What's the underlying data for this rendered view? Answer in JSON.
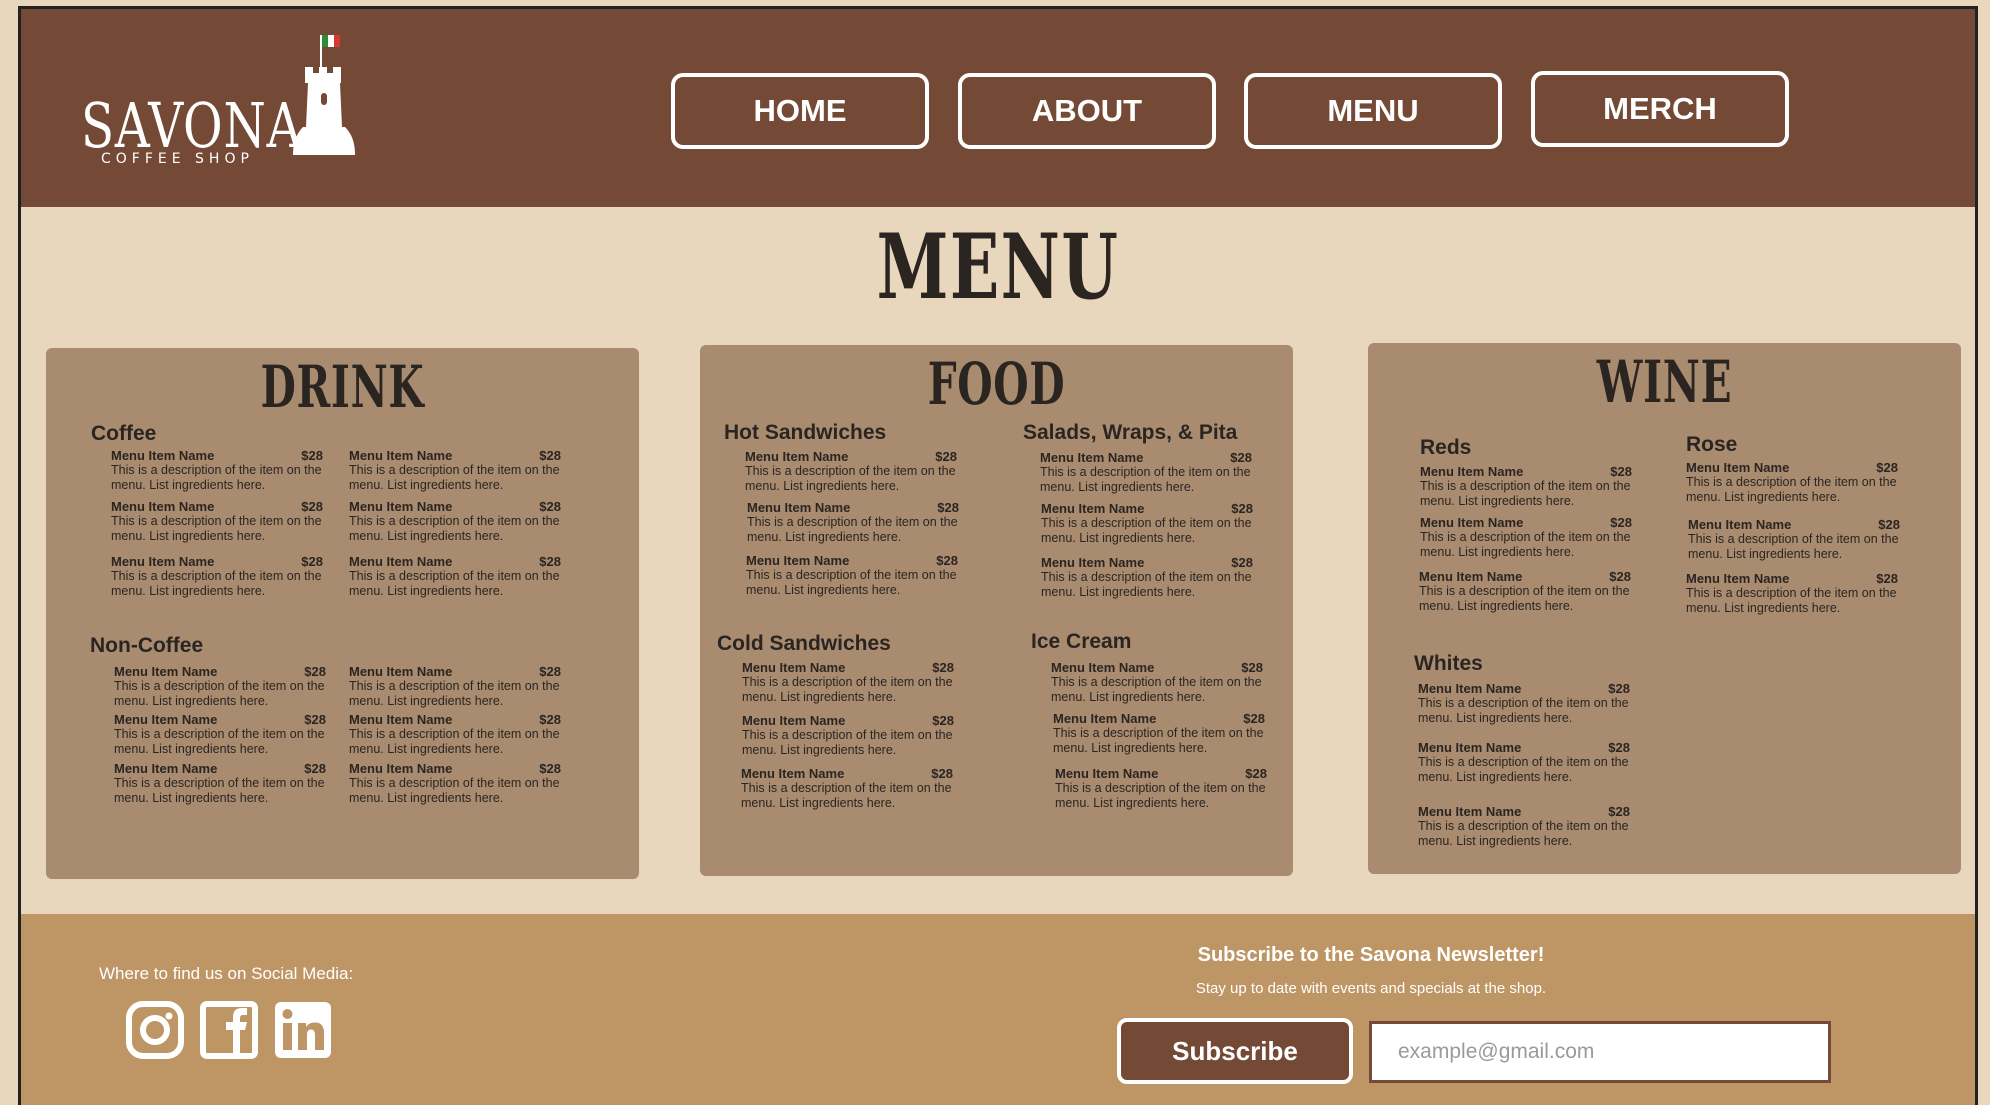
{
  "header": {
    "logo": {
      "name": "SAVONA",
      "tagline": "COFFEE SHOP"
    },
    "nav": [
      {
        "label": "HOME"
      },
      {
        "label": "ABOUT"
      },
      {
        "label": "MENU"
      },
      {
        "label": "MERCH"
      }
    ]
  },
  "page_title": "MENU",
  "cards": [
    {
      "title": "DRINK",
      "sections": [
        {
          "title": "Coffee",
          "items": [
            {
              "name": "Menu Item Name",
              "price": "$28",
              "desc": "This is a description of the item on the menu. List ingredients here."
            },
            {
              "name": "Menu Item Name",
              "price": "$28",
              "desc": "This is a description of the item on the menu. List ingredients here."
            },
            {
              "name": "Menu Item Name",
              "price": "$28",
              "desc": "This is a description of the item on the menu. List ingredients here."
            },
            {
              "name": "Menu Item Name",
              "price": "$28",
              "desc": "This is a description of the item on the menu. List ingredients here."
            },
            {
              "name": "Menu Item Name",
              "price": "$28",
              "desc": "This is a description of the item on the menu. List ingredients here."
            },
            {
              "name": "Menu Item Name",
              "price": "$28",
              "desc": "This is a description of the item on the menu. List ingredients here."
            }
          ]
        },
        {
          "title": "Non-Coffee",
          "items": [
            {
              "name": "Menu Item Name",
              "price": "$28",
              "desc": "This is a description of the item on the menu. List ingredients here."
            },
            {
              "name": "Menu Item Name",
              "price": "$28",
              "desc": "This is a description of the item on the menu. List ingredients here."
            },
            {
              "name": "Menu Item Name",
              "price": "$28",
              "desc": "This is a description of the item on the menu. List ingredients here."
            },
            {
              "name": "Menu Item Name",
              "price": "$28",
              "desc": "This is a description of the item on the menu. List ingredients here."
            },
            {
              "name": "Menu Item Name",
              "price": "$28",
              "desc": "This is a description of the item on the menu. List ingredients here."
            },
            {
              "name": "Menu Item Name",
              "price": "$28",
              "desc": "This is a description of the item on the menu. List ingredients here."
            }
          ]
        }
      ]
    },
    {
      "title": "FOOD",
      "sections": [
        {
          "title": "Hot Sandwiches",
          "items": [
            {
              "name": "Menu Item Name",
              "price": "$28",
              "desc": "This is a description of the item on the menu. List ingredients here."
            },
            {
              "name": "Menu Item Name",
              "price": "$28",
              "desc": "This is a description of the item on the menu. List ingredients here."
            },
            {
              "name": "Menu Item Name",
              "price": "$28",
              "desc": "This is a description of the item on the menu. List ingredients here."
            }
          ]
        },
        {
          "title": "Salads, Wraps, & Pita",
          "items": [
            {
              "name": "Menu Item Name",
              "price": "$28",
              "desc": "This is a description of the item on the menu. List ingredients here."
            },
            {
              "name": "Menu Item Name",
              "price": "$28",
              "desc": "This is a description of the item on the menu. List ingredients here."
            },
            {
              "name": "Menu Item Name",
              "price": "$28",
              "desc": "This is a description of the item on the menu. List ingredients here."
            }
          ]
        },
        {
          "title": "Cold Sandwiches",
          "items": [
            {
              "name": "Menu Item Name",
              "price": "$28",
              "desc": "This is a description of the item on the menu. List ingredients here."
            },
            {
              "name": "Menu Item Name",
              "price": "$28",
              "desc": "This is a description of the item on the menu. List ingredients here."
            },
            {
              "name": "Menu Item Name",
              "price": "$28",
              "desc": "This is a description of the item on the menu. List ingredients here."
            }
          ]
        },
        {
          "title": "Ice Cream",
          "items": [
            {
              "name": "Menu Item Name",
              "price": "$28",
              "desc": "This is a description of the item on the menu. List ingredients here."
            },
            {
              "name": "Menu Item Name",
              "price": "$28",
              "desc": "This is a description of the item on the menu. List ingredients here."
            },
            {
              "name": "Menu Item Name",
              "price": "$28",
              "desc": "This is a description of the item on the menu. List ingredients here."
            }
          ]
        }
      ]
    },
    {
      "title": "WINE",
      "sections": [
        {
          "title": "Reds",
          "items": [
            {
              "name": "Menu Item Name",
              "price": "$28",
              "desc": "This is a description of the item on the menu. List ingredients here."
            },
            {
              "name": "Menu Item Name",
              "price": "$28",
              "desc": "This is a description of the item on the menu. List ingredients here."
            },
            {
              "name": "Menu Item Name",
              "price": "$28",
              "desc": "This is a description of the item on the menu. List ingredients here."
            }
          ]
        },
        {
          "title": "Rose",
          "items": [
            {
              "name": "Menu Item Name",
              "price": "$28",
              "desc": "This is a description of the item on the menu. List ingredients here."
            },
            {
              "name": "Menu Item Name",
              "price": "$28",
              "desc": "This is a description of the item on the menu. List ingredients here."
            },
            {
              "name": "Menu Item Name",
              "price": "$28",
              "desc": "This is a description of the item on the menu. List ingredients here."
            }
          ]
        },
        {
          "title": "Whites",
          "items": [
            {
              "name": "Menu Item Name",
              "price": "$28",
              "desc": "This is a description of the item on the menu. List ingredients here."
            },
            {
              "name": "Menu Item Name",
              "price": "$28",
              "desc": "This is a description of the item on the menu. List ingredients here."
            },
            {
              "name": "Menu Item Name",
              "price": "$28",
              "desc": "This is a description of the item on the menu. List ingredients here."
            }
          ]
        }
      ]
    }
  ],
  "footer": {
    "social_label": "Where to find us on Social Media:",
    "social_icons": [
      "instagram-icon",
      "facebook-icon",
      "linkedin-icon"
    ],
    "newsletter": {
      "title": "Subscribe to the Savona Newsletter!",
      "subtitle": "Stay up to date with events and specials at the shop.",
      "button_label": "Subscribe",
      "email_placeholder": "example@gmail.com"
    }
  },
  "colors": {
    "header_bg": "#744935",
    "page_bg": "#e8d6bd",
    "card_bg": "#a98b70",
    "footer_bg": "#be9665",
    "text_dark": "#2b2521"
  }
}
